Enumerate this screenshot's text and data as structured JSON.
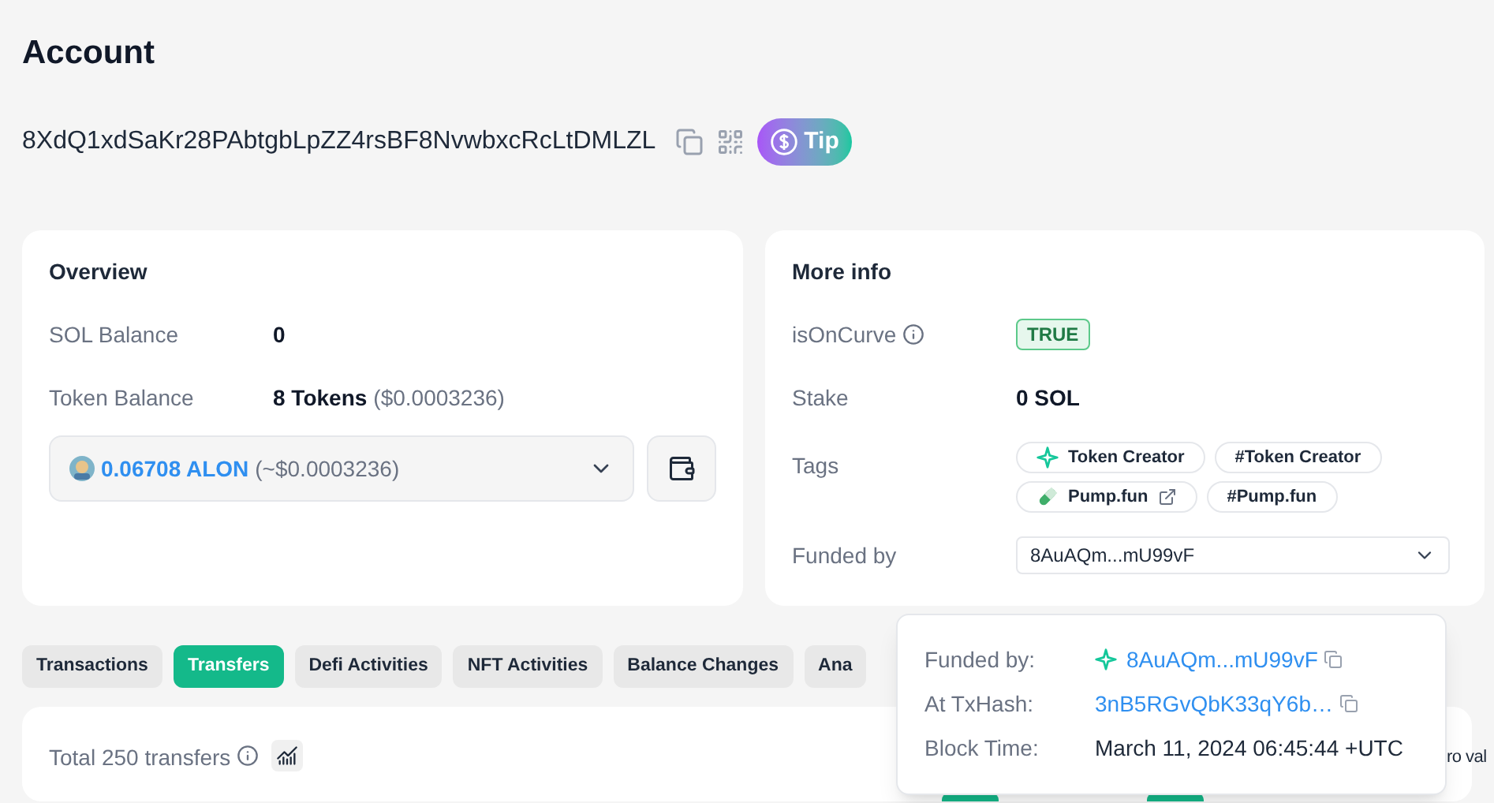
{
  "title": "Account",
  "address": "8XdQ1xdSaKr28PAbtgbLpZZ4rsBF8NvwbxcRcLtDMLZL",
  "tip_button": "Tip",
  "overview": {
    "title": "Overview",
    "sol_balance": {
      "label": "SOL Balance",
      "value": "0"
    },
    "token_balance": {
      "label": "Token Balance",
      "value": "8 Tokens",
      "usd": "($0.0003236)"
    },
    "token_select": {
      "amount": "0.06708 ALON",
      "usd": "(~$0.0003236)"
    }
  },
  "more_info": {
    "title": "More info",
    "is_on_curve": {
      "label": "isOnCurve",
      "value": "TRUE"
    },
    "stake": {
      "label": "Stake",
      "value": "0 SOL"
    },
    "tags": {
      "label": "Tags",
      "items": [
        {
          "kind": "sparkle",
          "text": "Token Creator"
        },
        {
          "kind": "plain",
          "text": "#Token Creator"
        },
        {
          "kind": "link",
          "text": "Pump.fun"
        },
        {
          "kind": "plain",
          "text": "#Pump.fun"
        }
      ]
    },
    "funded_by": {
      "label": "Funded by",
      "value": "8AuAQm...mU99vF"
    }
  },
  "tabs": [
    {
      "label": "Transactions",
      "selected": false
    },
    {
      "label": "Transfers",
      "selected": true
    },
    {
      "label": "Defi Activities",
      "selected": false
    },
    {
      "label": "NFT Activities",
      "selected": false
    },
    {
      "label": "Balance Changes",
      "selected": false
    },
    {
      "label": "Ana",
      "selected": false
    }
  ],
  "transfers": {
    "total": "Total 250 transfers",
    "filter_text": "ro val"
  },
  "popup": {
    "rows": [
      {
        "label": "Funded by:",
        "value": "8AuAQm...mU99vF",
        "kind": "link_icon"
      },
      {
        "label": "At TxHash:",
        "value": "3nB5RGvQbK33qY6b…",
        "kind": "link"
      },
      {
        "label": "Block Time:",
        "value": "March 11, 2024 06:45:44 +UTC",
        "kind": "text"
      }
    ]
  }
}
